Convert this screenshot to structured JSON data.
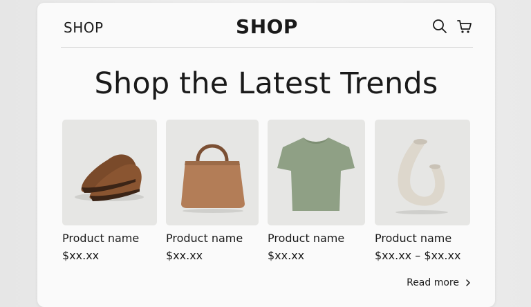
{
  "header": {
    "nav_label": "SHOP",
    "brand": "SHOP",
    "icons": [
      "search-icon",
      "cart-icon"
    ]
  },
  "hero": {
    "title": "Shop the Latest Trends"
  },
  "products": [
    {
      "name": "Product name",
      "price": "$xx.xx",
      "image": "brown leather loafers"
    },
    {
      "name": "Product name",
      "price": "$xx.xx",
      "image": "tan leather tote bag"
    },
    {
      "name": "Product name",
      "price": "$xx.xx",
      "image": "sage green t-shirt"
    },
    {
      "name": "Product name",
      "price": "$xx.xx – $xx.xx",
      "image": "white ceramic vase"
    }
  ],
  "footer": {
    "read_more": "Read more"
  }
}
